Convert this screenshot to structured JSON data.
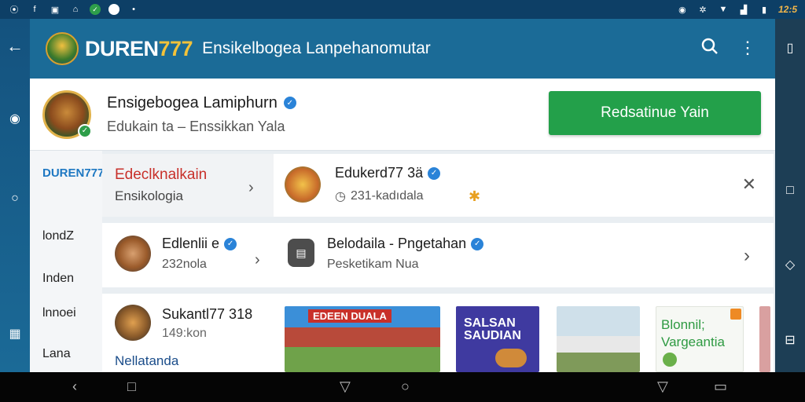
{
  "statusbar": {
    "left_icons": [
      "nfc-icon",
      "facebook-icon",
      "photo-icon",
      "wifi-icon",
      "whatsapp-icon",
      "app-icon",
      "dot-icon"
    ],
    "right_icons": [
      "alarm-icon",
      "settings-icon",
      "signal-icon",
      "signal-bars-icon",
      "battery-icon"
    ],
    "time": "12:5"
  },
  "appbar": {
    "brand_main": "DUREN",
    "brand_accent": "777",
    "title": "Ensikelbogea Lanpehanomutar"
  },
  "profile": {
    "name": "Ensigebogea Lamiphurn",
    "subtitle": "Edukain ta – Enssikkan Yala",
    "cta": "Redsatinue Yain"
  },
  "leftnav": {
    "brand": "DUREN777",
    "items": [
      "londZ",
      "Inden",
      "lnnoei",
      "Lana"
    ]
  },
  "row1": {
    "category_title": "Edeclknalkain",
    "category_sub": "Ensikologia",
    "item_name": "Edukerd77 3ä",
    "item_sub": "231-kadıdala"
  },
  "row2": {
    "left_name": "Edlenlii e",
    "left_sub": "232nola",
    "right_name": "Belodaila - Pngetahan",
    "right_sub": "Pesketikam Nua"
  },
  "row3": {
    "name": "Sukantl77 318",
    "sub": "149:kon",
    "tag": "Nellatanda",
    "cards": [
      {
        "caption": "EDEEN DUALA"
      },
      {
        "caption": "SALSAN SAUDIAN"
      },
      {
        "caption": ""
      },
      {
        "caption": "Blonnil; Vargeantia"
      }
    ]
  },
  "colors": {
    "appbar": "#1b6b97",
    "statusbar": "#0d3f66",
    "accent_green": "#23a04a",
    "verified_blue": "#2a83d8"
  }
}
